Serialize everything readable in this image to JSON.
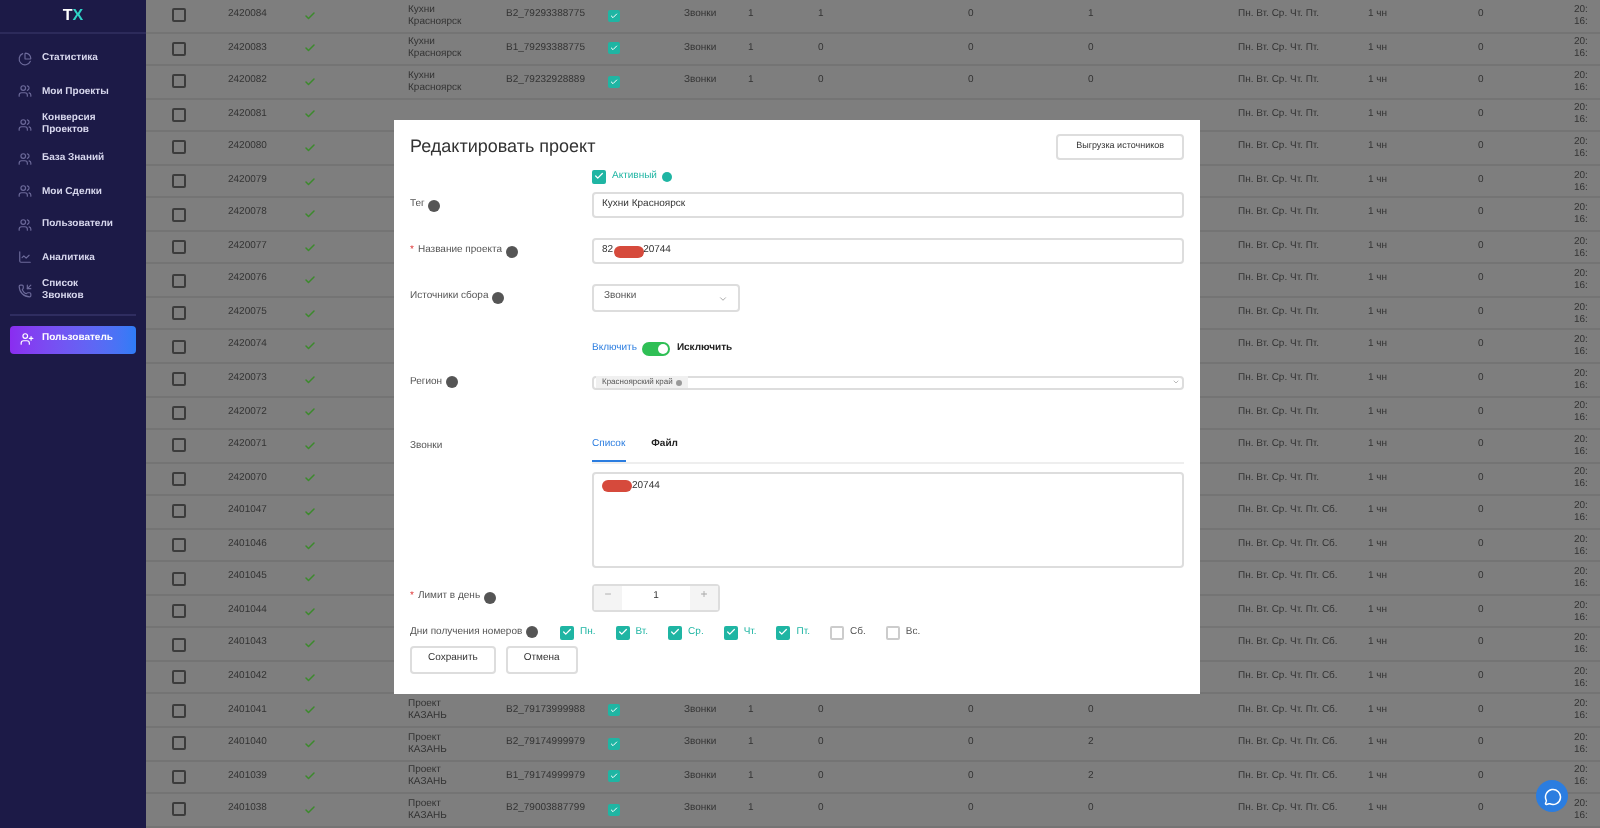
{
  "sidebar": {
    "logo_left": "T",
    "logo_right": "X",
    "items": [
      {
        "label": "Статистика"
      },
      {
        "label": "Мои Проекты"
      },
      {
        "label": "Конверсия Проектов"
      },
      {
        "label": "База Знаний"
      },
      {
        "label": "Мои Сделки"
      },
      {
        "label": "Пользователи"
      },
      {
        "label": "Аналитика"
      },
      {
        "label": "Список Звонков"
      }
    ],
    "user_button": "Пользователь"
  },
  "table": {
    "rows": [
      {
        "checked": false,
        "id": "2420084",
        "ok": true,
        "name": "Кухни Красноярск",
        "project": "B2_79293388775",
        "enabled": true,
        "source": "Звонки",
        "column_1": "1",
        "column_2": "1",
        "column_3": "0",
        "column_4": "1",
        "days": "Пн. Вт. Ср. Чт. Пт.",
        "limit": "1 чн",
        "column_5": "0",
        "date": "20: 16:"
      },
      {
        "checked": false,
        "id": "2420083",
        "ok": true,
        "name": "Кухни Красноярск",
        "project": "B1_79293388775",
        "enabled": true,
        "source": "Звонки",
        "column_1": "1",
        "column_2": "0",
        "column_3": "0",
        "column_4": "0",
        "days": "Пн. Вт. Ср. Чт. Пт.",
        "limit": "1 чн",
        "column_5": "0",
        "date": "20: 16:"
      },
      {
        "checked": false,
        "id": "2420082",
        "ok": true,
        "name": "Кухни Красноярск",
        "project": "B2_79232928889",
        "enabled": true,
        "source": "Звонки",
        "column_1": "1",
        "column_2": "0",
        "column_3": "0",
        "column_4": "0",
        "days": "Пн. Вт. Ср. Чт. Пт.",
        "limit": "1 чн",
        "column_5": "0",
        "date": "20: 16:"
      },
      {
        "checked": false,
        "id": "2420081",
        "ok": true,
        "days": "Пн. Вт. Ср. Чт. Пт.",
        "limit": "1 чн",
        "column_5": "0",
        "date": "20: 16:"
      },
      {
        "checked": false,
        "id": "2420080",
        "ok": true,
        "days": "Пн. Вт. Ср. Чт. Пт.",
        "limit": "1 чн",
        "column_5": "0",
        "date": "20: 16:"
      },
      {
        "checked": false,
        "id": "2420079",
        "ok": true,
        "days": "Пн. Вт. Ср. Чт. Пт.",
        "limit": "1 чн",
        "column_5": "0",
        "date": "20: 16:"
      },
      {
        "checked": false,
        "id": "2420078",
        "ok": true,
        "days": "Пн. Вт. Ср. Чт. Пт.",
        "limit": "1 чн",
        "column_5": "0",
        "date": "20: 16:"
      },
      {
        "checked": false,
        "id": "2420077",
        "ok": true,
        "days": "Пн. Вт. Ср. Чт. Пт.",
        "limit": "1 чн",
        "column_5": "0",
        "date": "20: 16:"
      },
      {
        "checked": false,
        "id": "2420076",
        "ok": true,
        "days": "Пн. Вт. Ср. Чт. Пт.",
        "limit": "1 чн",
        "column_5": "0",
        "date": "20: 16:"
      },
      {
        "checked": false,
        "id": "2420075",
        "ok": true,
        "days": "Пн. Вт. Ср. Чт. Пт.",
        "limit": "1 чн",
        "column_5": "0",
        "date": "20: 16:"
      },
      {
        "checked": false,
        "id": "2420074",
        "ok": true,
        "days": "Пн. Вт. Ср. Чт. Пт.",
        "limit": "1 чн",
        "column_5": "0",
        "date": "20: 16:"
      },
      {
        "checked": false,
        "id": "2420073",
        "ok": true,
        "days": "Пн. Вт. Ср. Чт. Пт.",
        "limit": "1 чн",
        "column_5": "0",
        "date": "20: 16:"
      },
      {
        "checked": false,
        "id": "2420072",
        "ok": true,
        "days": "Пн. Вт. Ср. Чт. Пт.",
        "limit": "1 чн",
        "column_5": "0",
        "date": "20: 16:"
      },
      {
        "checked": false,
        "id": "2420071",
        "ok": true,
        "days": "Пн. Вт. Ср. Чт. Пт.",
        "limit": "1 чн",
        "column_5": "0",
        "date": "20: 16:"
      },
      {
        "checked": false,
        "id": "2420070",
        "ok": true,
        "days": "Пн. Вт. Ср. Чт. Пт.",
        "limit": "1 чн",
        "column_5": "0",
        "date": "20: 16:"
      },
      {
        "checked": false,
        "id": "2401047",
        "ok": true,
        "days": "Пн. Вт. Ср. Чт. Пт. Сб.",
        "limit": "1 чн",
        "column_5": "0",
        "date": "20: 16:"
      },
      {
        "checked": false,
        "id": "2401046",
        "ok": true,
        "days": "Пн. Вт. Ср. Чт. Пт. Сб.",
        "limit": "1 чн",
        "column_5": "0",
        "date": "20: 16:"
      },
      {
        "checked": false,
        "id": "2401045",
        "ok": true,
        "days": "Пн. Вт. Ср. Чт. Пт. Сб.",
        "limit": "1 чн",
        "column_5": "0",
        "date": "20: 16:"
      },
      {
        "checked": false,
        "id": "2401044",
        "ok": true,
        "days": "Пн. Вт. Ср. Чт. Пт. Сб.",
        "limit": "1 чн",
        "column_5": "0",
        "date": "20: 16:"
      },
      {
        "checked": false,
        "id": "2401043",
        "ok": true,
        "days": "Пн. Вт. Ср. Чт. Пт. Сб.",
        "limit": "1 чн",
        "column_5": "0",
        "date": "20: 16:"
      },
      {
        "checked": false,
        "id": "2401042",
        "ok": true,
        "days": "Пн. Вт. Ср. Чт. Пт. Сб.",
        "limit": "1 чн",
        "column_5": "0",
        "date": "20: 16:"
      },
      {
        "checked": false,
        "id": "2401041",
        "ok": true,
        "name": "Проект КАЗАНЬ",
        "project": "B2_79173999988",
        "enabled": true,
        "source": "Звонки",
        "column_1": "1",
        "column_2": "0",
        "column_3": "0",
        "column_4": "0",
        "days": "Пн. Вт. Ср. Чт. Пт. Сб.",
        "limit": "1 чн",
        "column_5": "0",
        "date": "20: 16:"
      },
      {
        "checked": false,
        "id": "2401040",
        "ok": true,
        "name": "Проект КАЗАНЬ",
        "project": "B2_79174999979",
        "enabled": true,
        "source": "Звонки",
        "column_1": "1",
        "column_2": "0",
        "column_3": "0",
        "column_4": "2",
        "days": "Пн. Вт. Ср. Чт. Пт. Сб.",
        "limit": "1 чн",
        "column_5": "0",
        "date": "20: 16:"
      },
      {
        "checked": false,
        "id": "2401039",
        "ok": true,
        "name": "Проект КАЗАНЬ",
        "project": "B1_79174999979",
        "enabled": true,
        "source": "Звонки",
        "column_1": "1",
        "column_2": "0",
        "column_3": "0",
        "column_4": "2",
        "days": "Пн. Вт. Ср. Чт. Пт. Сб.",
        "limit": "1 чн",
        "column_5": "0",
        "date": "20: 16:"
      },
      {
        "checked": false,
        "id": "2401038",
        "ok": true,
        "name": "Проект КАЗАНЬ",
        "project": "B2_79003887799",
        "enabled": true,
        "source": "Звонки",
        "column_1": "1",
        "column_2": "0",
        "column_3": "0",
        "column_4": "0",
        "days": "Пн. Вт. Ср. Чт. Пт. Сб.",
        "limit": "1 чн",
        "column_5": "0",
        "date": "20: 16:"
      }
    ]
  },
  "modal": {
    "title": "Редактировать проект",
    "export_button": "Выгрузка источников",
    "active": {
      "label": "Активный",
      "checked": true
    },
    "tag": {
      "label": "Тег",
      "value": "Кухни Красноярск"
    },
    "name": {
      "label": "Название проекта",
      "required_mark": "*",
      "value_start": "82",
      "value_end": "20744"
    },
    "source": {
      "label": "Источники сбора",
      "value": "Звонки"
    },
    "toggle": {
      "left_label": "Включить",
      "right_label": "Исключить",
      "on": true
    },
    "region": {
      "label": "Регион",
      "tags": [
        "Красноярский край"
      ]
    },
    "calls": {
      "label": "Звонки",
      "tabs": [
        {
          "label": "Список",
          "selected": true
        },
        {
          "label": "Файл",
          "selected": false
        }
      ],
      "value_end": "20744"
    },
    "limit": {
      "label": "Лимит в день",
      "required_mark": "*",
      "minus": "−",
      "value": "1",
      "plus": "+"
    },
    "days": {
      "label": "Дни получения номеров",
      "items": [
        {
          "label": "Пн.",
          "checked": true
        },
        {
          "label": "Вт.",
          "checked": true
        },
        {
          "label": "Ср.",
          "checked": true
        },
        {
          "label": "Чт.",
          "checked": true
        },
        {
          "label": "Пт.",
          "checked": true
        },
        {
          "label": "Сб.",
          "checked": false
        },
        {
          "label": "Вс.",
          "checked": false
        }
      ]
    },
    "buttons": [
      "Сохранить",
      "Отмена"
    ]
  }
}
